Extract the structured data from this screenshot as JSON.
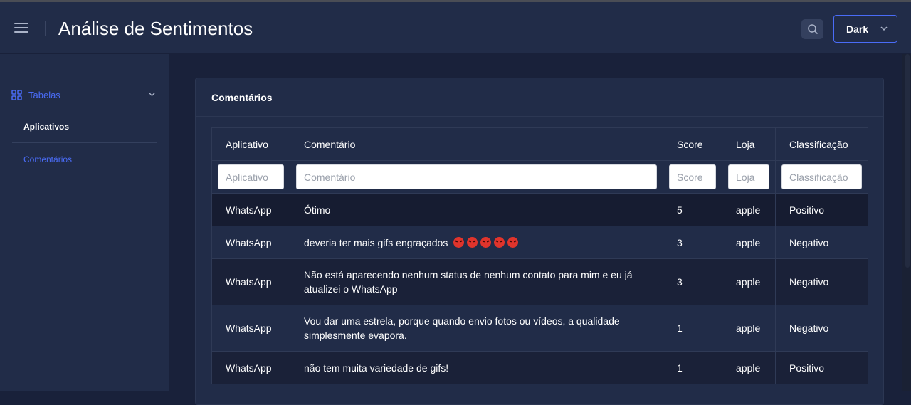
{
  "header": {
    "title": "Análise de Sentimentos",
    "theme_value": "Dark"
  },
  "sidebar": {
    "group_label": "Tabelas",
    "items": [
      {
        "label": "Aplicativos",
        "active": true
      },
      {
        "label": "Comentários",
        "active": false
      }
    ]
  },
  "card": {
    "title": "Comentários"
  },
  "table": {
    "headers": [
      "Aplicativo",
      "Comentário",
      "Score",
      "Loja",
      "Classificação"
    ],
    "filters": [
      "Aplicativo",
      "Comentário",
      "Score",
      "Loja",
      "Classificação"
    ],
    "rows": [
      {
        "app": "WhatsApp",
        "comment": "Ótimo",
        "score": "5",
        "store": "apple",
        "class": "Positivo"
      },
      {
        "app": "WhatsApp",
        "comment": "deveria ter mais gifs engraçados",
        "score": "3",
        "store": "apple",
        "class": "Negativo"
      },
      {
        "app": "WhatsApp",
        "comment": "Não está aparecendo nenhum status de nenhum contato para mim e eu já atualizei o WhatsApp",
        "score": "3",
        "store": "apple",
        "class": "Negativo"
      },
      {
        "app": "WhatsApp",
        "comment": "Vou dar uma estrela, porque quando envio fotos ou vídeos, a qualidade simplesmente evapora.",
        "score": "1",
        "store": "apple",
        "class": "Negativo"
      },
      {
        "app": "WhatsApp",
        "comment": "não tem muita variedade de gifs!",
        "score": "1",
        "store": "apple",
        "class": "Positivo"
      }
    ]
  },
  "icons": {
    "menu": "hamburger-icon",
    "search": "search-icon",
    "theme_chevron": "chevron-down-icon",
    "group": "grid-icon",
    "group_chevron": "chevron-down-icon",
    "emoji": "angry-face-emoji"
  },
  "colors": {
    "accent": "#4a6cf7",
    "header_bg": "#212c48",
    "page_bg": "#19213a",
    "emoji": "#e0342c"
  }
}
